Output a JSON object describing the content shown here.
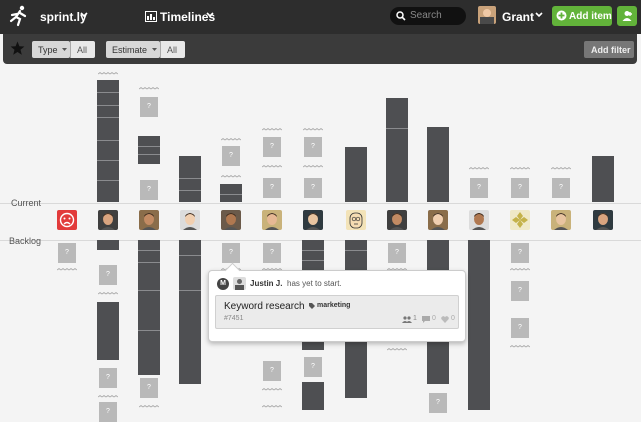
{
  "app": {
    "name": "sprint.ly"
  },
  "nav": {
    "timelines_label": "Timelines",
    "search_placeholder": "Search",
    "user_name": "Grant",
    "add_item_label": "Add item"
  },
  "filters": {
    "chips": [
      {
        "label": "Type",
        "value": "All"
      },
      {
        "label": "Estimate",
        "value": "All"
      }
    ],
    "add_filter_label": "Add filter"
  },
  "board": {
    "current_label": "Current",
    "backlog_label": "Backlog",
    "box_glyph": "?"
  },
  "popup": {
    "user_initial": "M",
    "user_name": "Justin J.",
    "status_text": "has yet to start.",
    "item_title": "Keyword research",
    "item_tag": "marketing",
    "item_number": "#7451",
    "assignee_count": "1",
    "comment_count": "0",
    "favorite_count": "0"
  },
  "colors": {
    "accent_green": "#62b33a",
    "bar_dark": "#4e4f52",
    "box_grey": "#b9b9b9",
    "nav_bg": "#2d2d2d"
  }
}
